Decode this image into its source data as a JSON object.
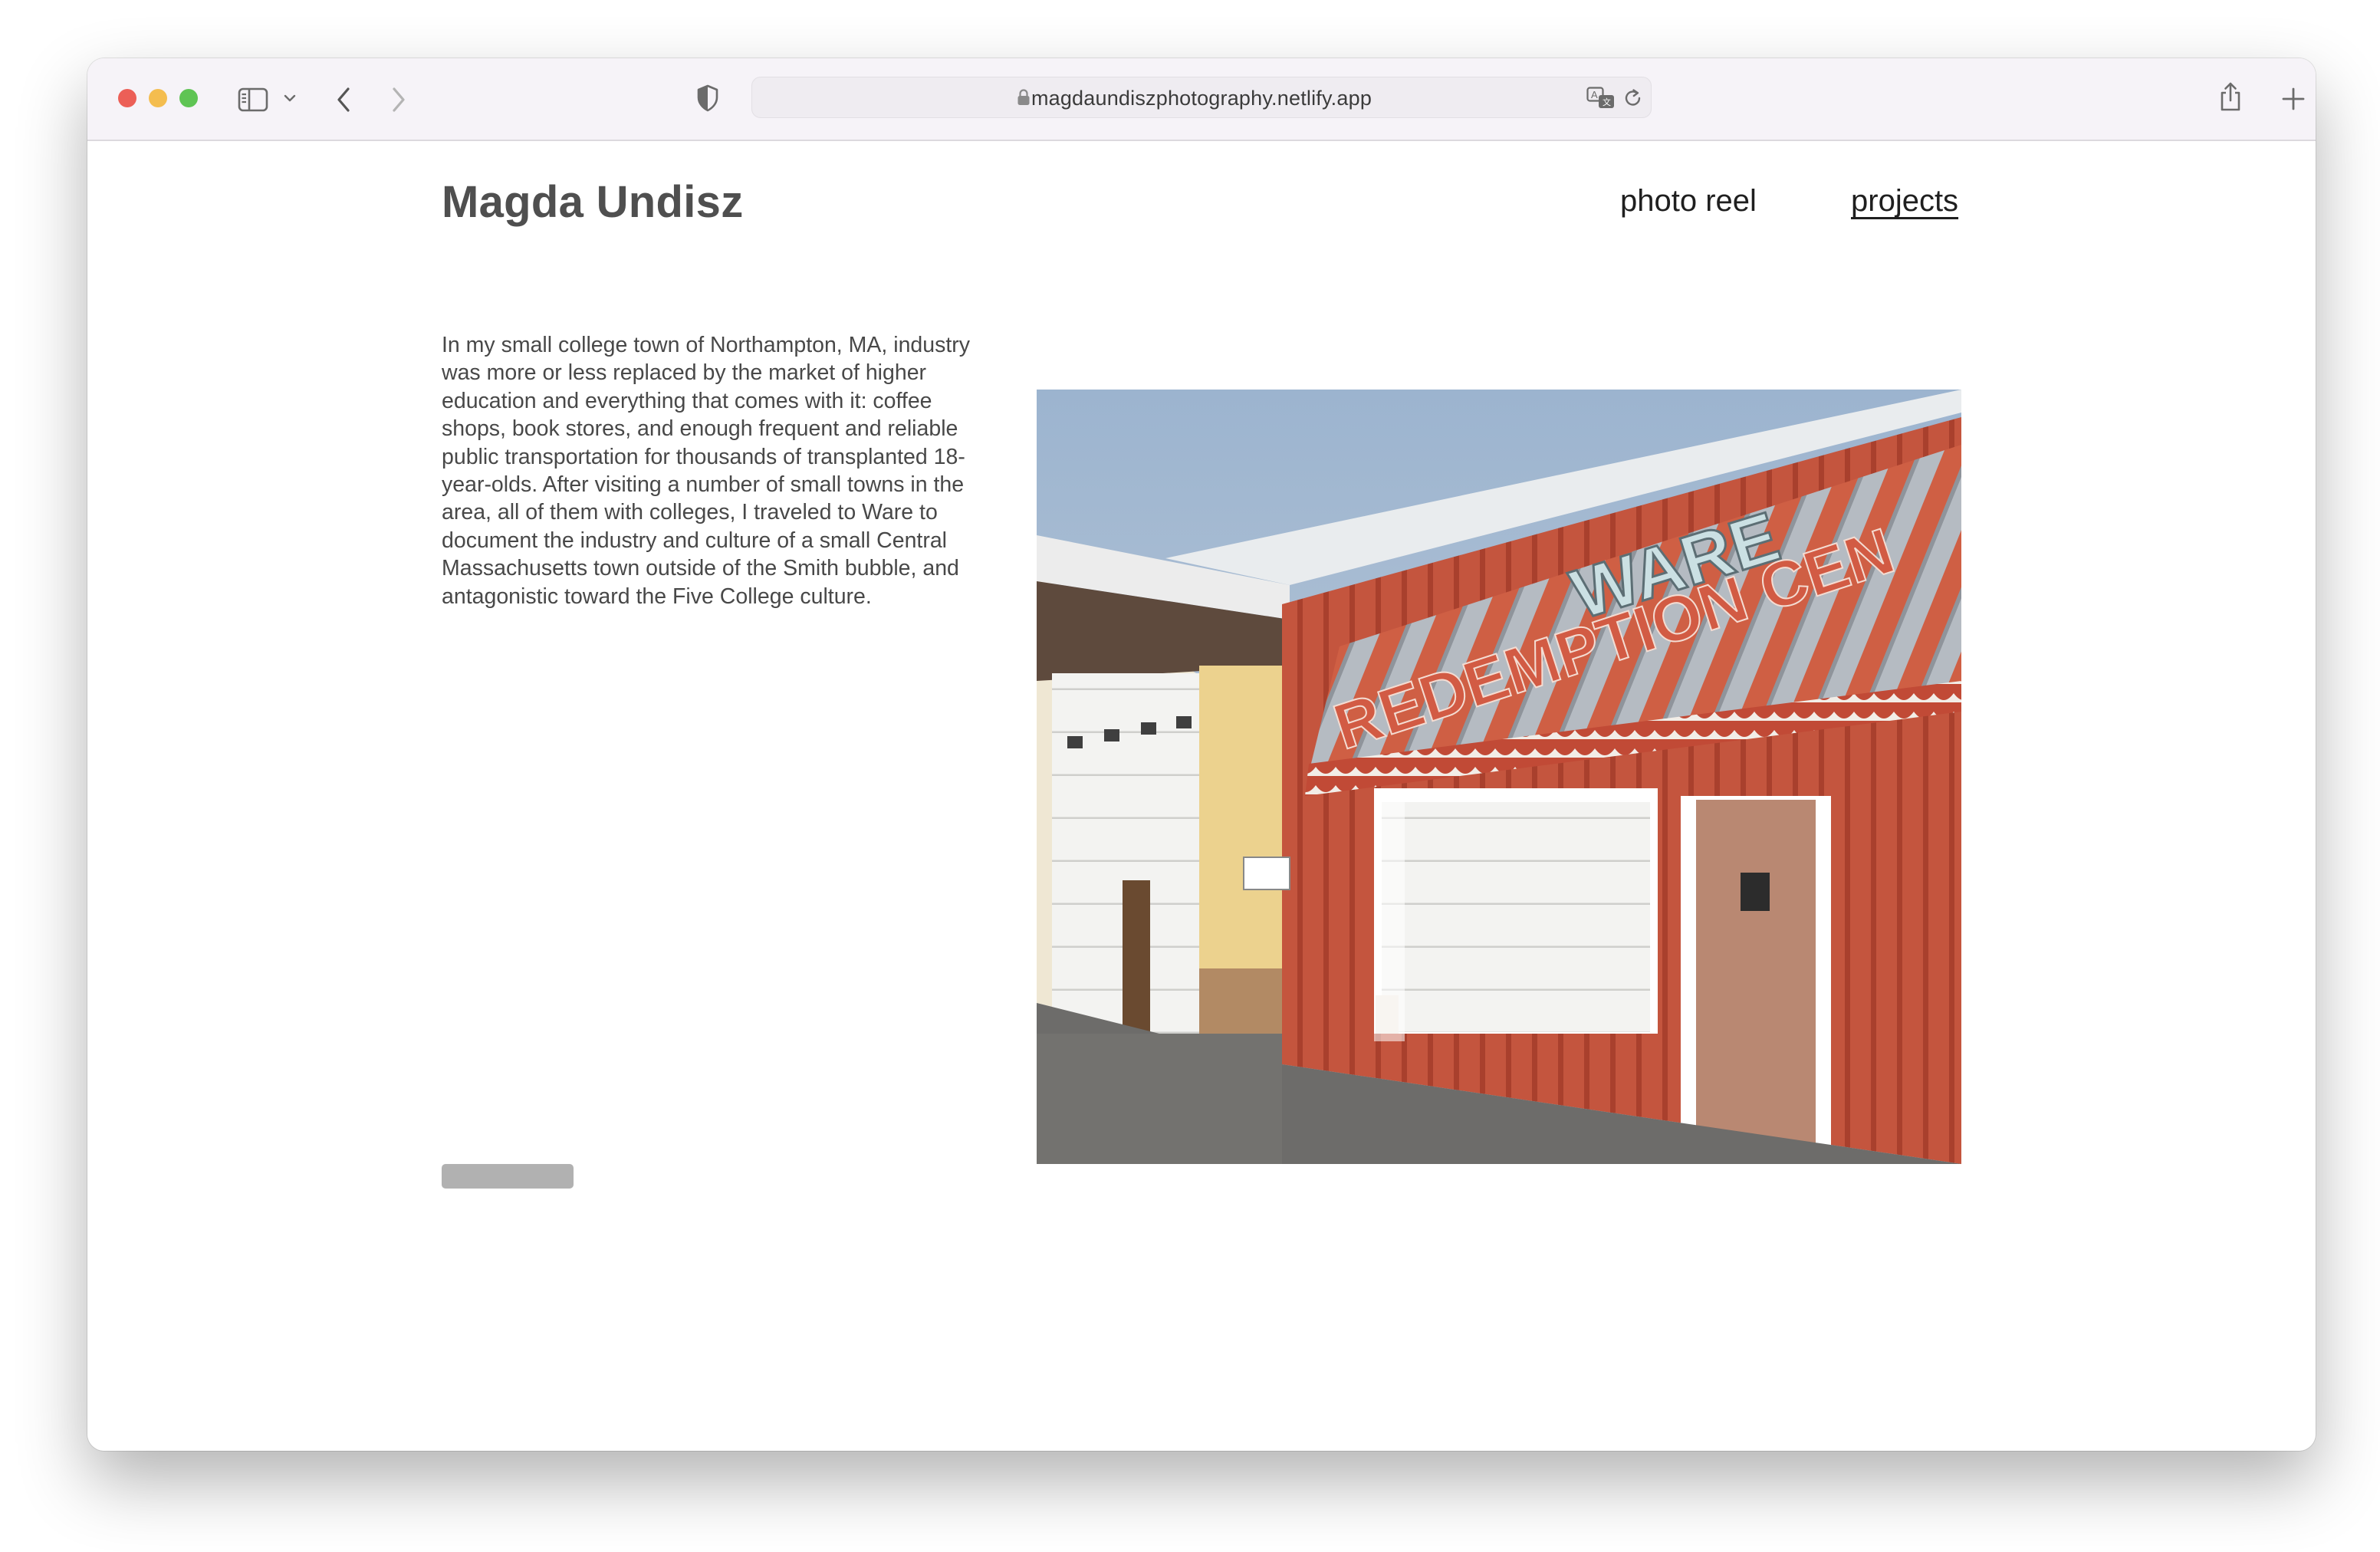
{
  "browser": {
    "url": "magdaundiszphotography.netlify.app",
    "icons": [
      "sidebar-icon",
      "chevron-down-icon",
      "back-icon",
      "forward-icon",
      "shield-icon",
      "lock-icon",
      "translate-icon",
      "reload-icon",
      "share-icon",
      "plus-icon",
      "tab-overview-icon"
    ]
  },
  "site": {
    "title": "Magda Undisz",
    "nav": [
      {
        "label": "photo reel",
        "active": false
      },
      {
        "label": "projects",
        "active": true
      }
    ]
  },
  "project": {
    "description": "In my small college town of Northampton, MA, industry was more or less replaced by the market of higher education and everything that comes with it: coffee shops, book stores, and enough frequent and reliable public transportation for thousands of transplanted 18-year-olds. After visiting a number of small towns in the area, all of them with colleges, I traveled to Ware to document the industry and culture of a small Central Massachusetts town outside of the Smith bubble, and antagonistic toward the Five College culture.",
    "photo": {
      "sign_line1": "WARE",
      "sign_line2": "REDEMPTION CEN"
    }
  },
  "colors": {
    "accent_red": "#c4553e",
    "sky": "#a9bdd3",
    "title_gray": "#4f4f4f"
  }
}
